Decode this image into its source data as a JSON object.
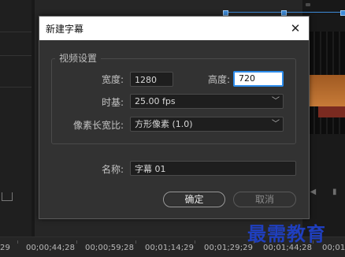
{
  "dialog": {
    "title": "新建字幕",
    "group_title": "视频设置",
    "width_label": "宽度:",
    "width_value": "1280",
    "height_label": "高度:",
    "height_value": "720",
    "timebase_label": "时基:",
    "timebase_value": "25.00 fps",
    "par_label": "像素长宽比:",
    "par_value": "方形像素 (1.0)",
    "name_label": "名称:",
    "name_value": "字幕 01",
    "ok_label": "确定",
    "cancel_label": "取消"
  },
  "timeline": {
    "timecodes": [
      "29",
      "00;00;44;28",
      "00;00;59;28",
      "00;01;14;29",
      "00;01;29;29",
      "00;01;44;28",
      "00;01"
    ]
  },
  "watermark": "最需教育"
}
